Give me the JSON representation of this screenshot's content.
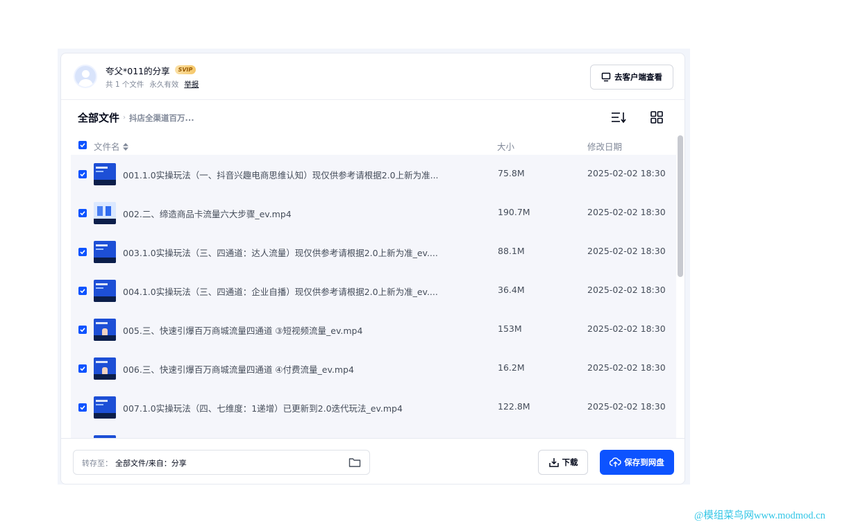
{
  "share": {
    "title": "夸父*011的分享",
    "badge": "SVIP",
    "file_count": "共 1 个文件",
    "validity": "永久有效",
    "report": "举报",
    "client_button": "去客户端查看"
  },
  "breadcrumb": {
    "root": "全部文件",
    "separator": "›",
    "current": "抖店全渠道百万..."
  },
  "table": {
    "columns": {
      "name": "文件名",
      "size": "大小",
      "modified": "修改日期"
    },
    "rows": [
      {
        "name": "001.1.0实操玩法（一、抖音兴趣电商思维认知）现仅供参考请根据2.0上新为准...",
        "size": "75.8M",
        "date": "2025-02-02 18:30",
        "checked": true,
        "thumb": "blue"
      },
      {
        "name": "002.二、缔造商品卡流量六大步骤_ev.mp4",
        "size": "190.7M",
        "date": "2025-02-02 18:30",
        "checked": true,
        "thumb": "light"
      },
      {
        "name": "003.1.0实操玩法（三、四通道：达人流量）现仅供参考请根据2.0上新为准_ev....",
        "size": "88.1M",
        "date": "2025-02-02 18:30",
        "checked": true,
        "thumb": "blue"
      },
      {
        "name": "004.1.0实操玩法（三、四通道：企业自播）现仅供参考请根据2.0上新为准_ev....",
        "size": "36.4M",
        "date": "2025-02-02 18:30",
        "checked": true,
        "thumb": "blue"
      },
      {
        "name": "005.三、快速引爆百万商城流量四通道 ③短视频流量_ev.mp4",
        "size": "153M",
        "date": "2025-02-02 18:30",
        "checked": true,
        "thumb": "person"
      },
      {
        "name": "006.三、快速引爆百万商城流量四通道 ④付费流量_ev.mp4",
        "size": "16.2M",
        "date": "2025-02-02 18:30",
        "checked": true,
        "thumb": "person"
      },
      {
        "name": "007.1.0实操玩法（四、七维度：1递增）已更新到2.0迭代玩法_ev.mp4",
        "size": "122.8M",
        "date": "2025-02-02 18:30",
        "checked": true,
        "thumb": "blue"
      }
    ]
  },
  "footer": {
    "save_to_label": "转存至：",
    "save_to_value": "全部文件/来自：分享",
    "download_button": "下载",
    "save_button": "保存到网盘"
  },
  "watermark": "@模组菜鸟网www.modmod.cn",
  "colors": {
    "accent": "#0d53ff",
    "row_bg": "#f5f6fb",
    "watermark": "#33c6e6"
  }
}
